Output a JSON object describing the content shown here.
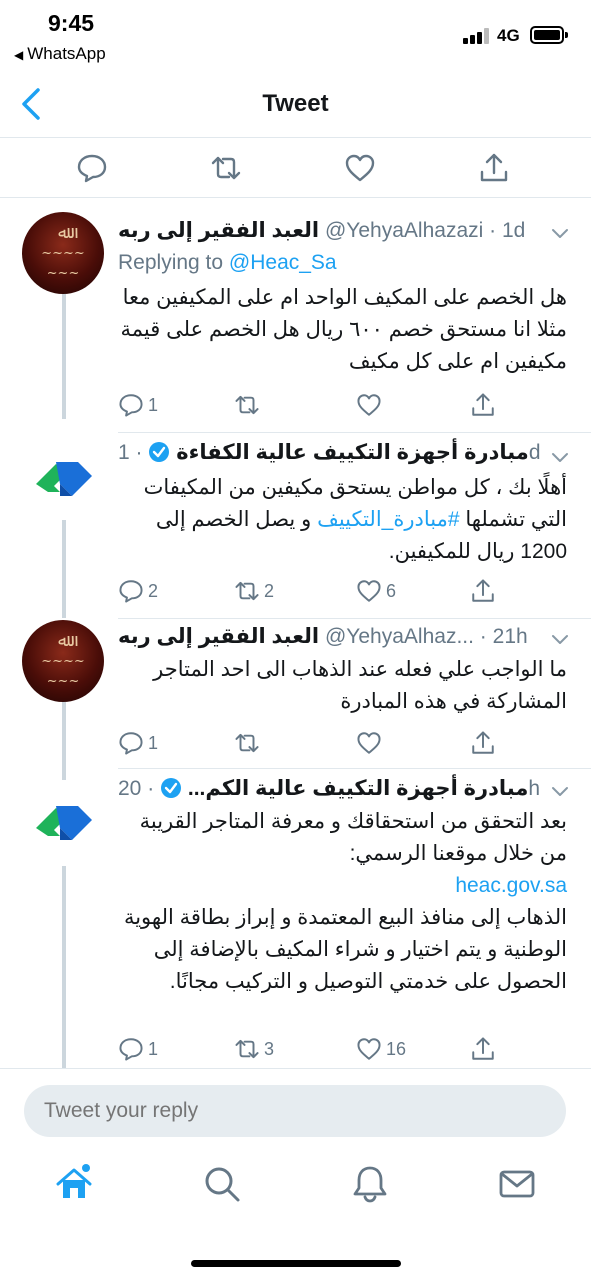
{
  "status": {
    "time": "9:45",
    "back_app": "WhatsApp",
    "network": "4G"
  },
  "nav": {
    "title": "Tweet"
  },
  "tweets": [
    {
      "name": "العبد الفقير إلى ربه",
      "handle": "@YehyaAlhazazi",
      "time": "1d",
      "replying_label": "Replying to",
      "replying_to": "@Heac_Sa",
      "text": "هل الخصم على المكيف الواحد ام على المكيفين معا مثلا انا مستحق خصم ٦٠٠ ريال هل الخصم على قيمة مكيفين ام على كل مكيف",
      "replies": "1",
      "retweets": "",
      "likes": ""
    },
    {
      "name": "مبادرة أجهزة التكييف عالية الكفاءة",
      "handle": "",
      "time": "1d",
      "text_before": "أهلًا بك ، كل مواطن يستحق مكيفين من المكيفات التي تشملها ",
      "hashtag": "#مبادرة_التكييف",
      "text_after": " و يصل الخصم إلى 1200 ريال للمكيفين.",
      "replies": "2",
      "retweets": "2",
      "likes": "6"
    },
    {
      "name": "العبد الفقير إلى ربه",
      "handle": "@YehyaAlhaz...",
      "time": "21h",
      "text": "ما الواجب علي فعله عند الذهاب الى احد المتاجر المشاركة في هذه المبادرة",
      "replies": "1",
      "retweets": "",
      "likes": ""
    },
    {
      "name": "مبادرة أجهزة التكييف عالية الكم...",
      "handle": "",
      "time": "20h",
      "text_before": "بعد التحقق من استحقاقك و معرفة المتاجر القريبة من خلال موقعنا الرسمي:",
      "link": "heac.gov.sa",
      "text_after": "الذهاب إلى منافذ البيع المعتمدة و إبراز بطاقة الهوية الوطنية و يتم اختيار و شراء المكيف بالإضافة إلى الحصول على خدمتي التوصيل و التركيب مجانًا.",
      "replies": "1",
      "retweets": "3",
      "likes": "16"
    }
  ],
  "composer": {
    "placeholder": "Tweet your reply"
  },
  "icons": {
    "accent": "#1da1f2",
    "action_gray": "#657786",
    "verified": "#1da1f2",
    "tabs": [
      "home-icon",
      "search-icon",
      "notifications-icon",
      "messages-icon"
    ]
  }
}
